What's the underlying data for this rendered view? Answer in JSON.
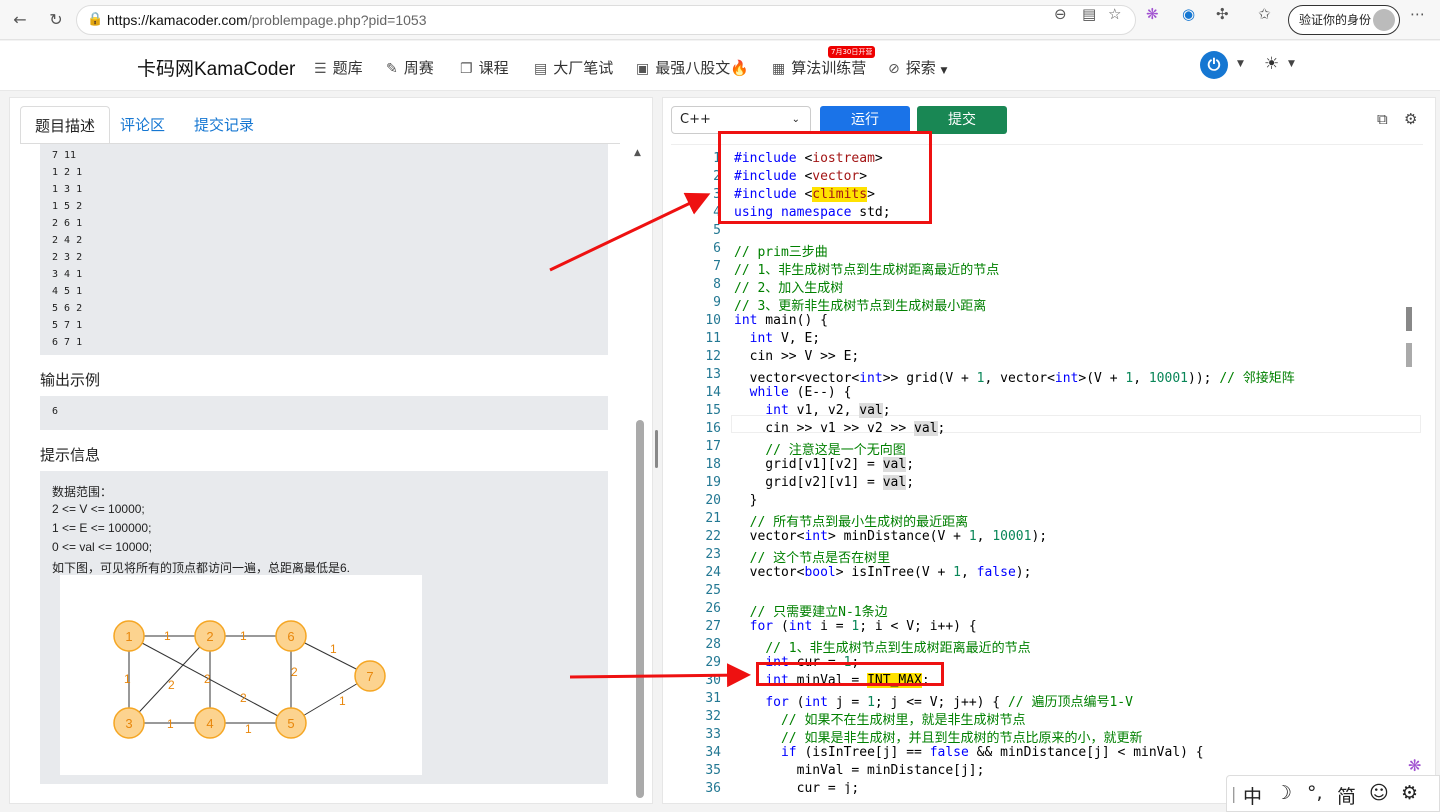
{
  "browser": {
    "url_host": "https://kamacoder.com",
    "url_path": "/problempage.php?pid=1053",
    "verify_label": "验证你的身份"
  },
  "nav": {
    "brand": "卡码网KamaCoder",
    "items": [
      {
        "icon": "list-icon",
        "label": "题库"
      },
      {
        "icon": "pencil-icon",
        "label": "周赛"
      },
      {
        "icon": "book-icon",
        "label": "课程"
      },
      {
        "icon": "journal-icon",
        "label": "大厂笔试"
      },
      {
        "icon": "code-doc-icon",
        "label": "最强八股文🔥"
      },
      {
        "icon": "calendar-icon",
        "label": "算法训练营"
      },
      {
        "icon": "compass-icon",
        "label": "探索"
      }
    ],
    "camp_badge": "7月30日开营"
  },
  "left": {
    "tabs": [
      "题目描述",
      "评论区",
      "提交记录"
    ],
    "input_sample": [
      "7 11",
      "1 2 1",
      "1 3 1",
      "1 5 2",
      "2 6 1",
      "2 4 2",
      "2 3 2",
      "3 4 1",
      "4 5 1",
      "5 6 2",
      "5 7 1",
      "6 7 1"
    ],
    "output_title": "输出示例",
    "output_value": "6",
    "hint_title": "提示信息",
    "hint_lines": [
      "数据范围：",
      "2 <= V <= 10000;",
      "1 <= E <= 100000;",
      "0 <= val <= 10000;",
      "如下图，可见将所有的顶点都访问一遍，总距离最低是6."
    ],
    "graph": {
      "nodes": [
        "1",
        "2",
        "3",
        "4",
        "5",
        "6",
        "7"
      ],
      "edge_weights": [
        "1",
        "1",
        "1",
        "2",
        "2",
        "2",
        "1",
        "2",
        "1",
        "1",
        "1"
      ]
    }
  },
  "editor": {
    "language": "C++",
    "run_label": "运行",
    "submit_label": "提交",
    "line_numbers": [
      "1",
      "2",
      "3",
      "4",
      "5",
      "6",
      "7",
      "8",
      "9",
      "10",
      "11",
      "12",
      "13",
      "14",
      "15",
      "16",
      "17",
      "18",
      "19",
      "20",
      "21",
      "22",
      "23",
      "24",
      "25",
      "26",
      "27",
      "28",
      "29",
      "30",
      "31",
      "32",
      "33",
      "34",
      "35",
      "36"
    ],
    "lines": [
      "#include <iostream>",
      "#include <vector>",
      "#include <climits>",
      "using namespace std;",
      "",
      "// prim三步曲",
      "// 1、非生成树节点到生成树距离最近的节点",
      "// 2、加入生成树",
      "// 3、更新非生成树节点到生成树最小距离",
      "int main() {",
      "  int V, E;",
      "  cin >> V >> E;",
      "  vector<vector<int>> grid(V + 1, vector<int>(V + 1, 10001)); // 邻接矩阵",
      "  while (E--) {",
      "    int v1, v2, val;",
      "    cin >> v1 >> v2 >> val;",
      "    // 注意这是一个无向图",
      "    grid[v1][v2] = val;",
      "    grid[v2][v1] = val;",
      "  }",
      "  // 所有节点到最小生成树的最近距离",
      "  vector<int> minDistance(V + 1, 10001);",
      "  // 这个节点是否在树里",
      "  vector<bool> isInTree(V + 1, false);",
      "",
      "  // 只需要建立N-1条边",
      "  for (int i = 1; i < V; i++) {",
      "    // 1、非生成树节点到生成树距离最近的节点",
      "    int cur = 1;",
      "    int minVal = INT_MAX;",
      "    for (int j = 1; j <= V; j++) { // 遍历顶点编号1-V",
      "      // 如果不在生成树里，就是非生成树节点",
      "      // 如果是非生成树，并且到生成树的节点比原来的小，就更新",
      "      if (isInTree[j] == false && minDistance[j] < minVal) {",
      "        minVal = minDistance[j];",
      "        cur = j;"
    ]
  },
  "ime": {
    "items": [
      "中",
      "☽",
      "°,",
      "简",
      "☺",
      "⚙"
    ]
  },
  "colors": {
    "primary": "#1a73e8",
    "success": "#198754",
    "annotation": "#e11111",
    "node_fill": "#fcd38f",
    "node_stroke": "#f5a623"
  }
}
